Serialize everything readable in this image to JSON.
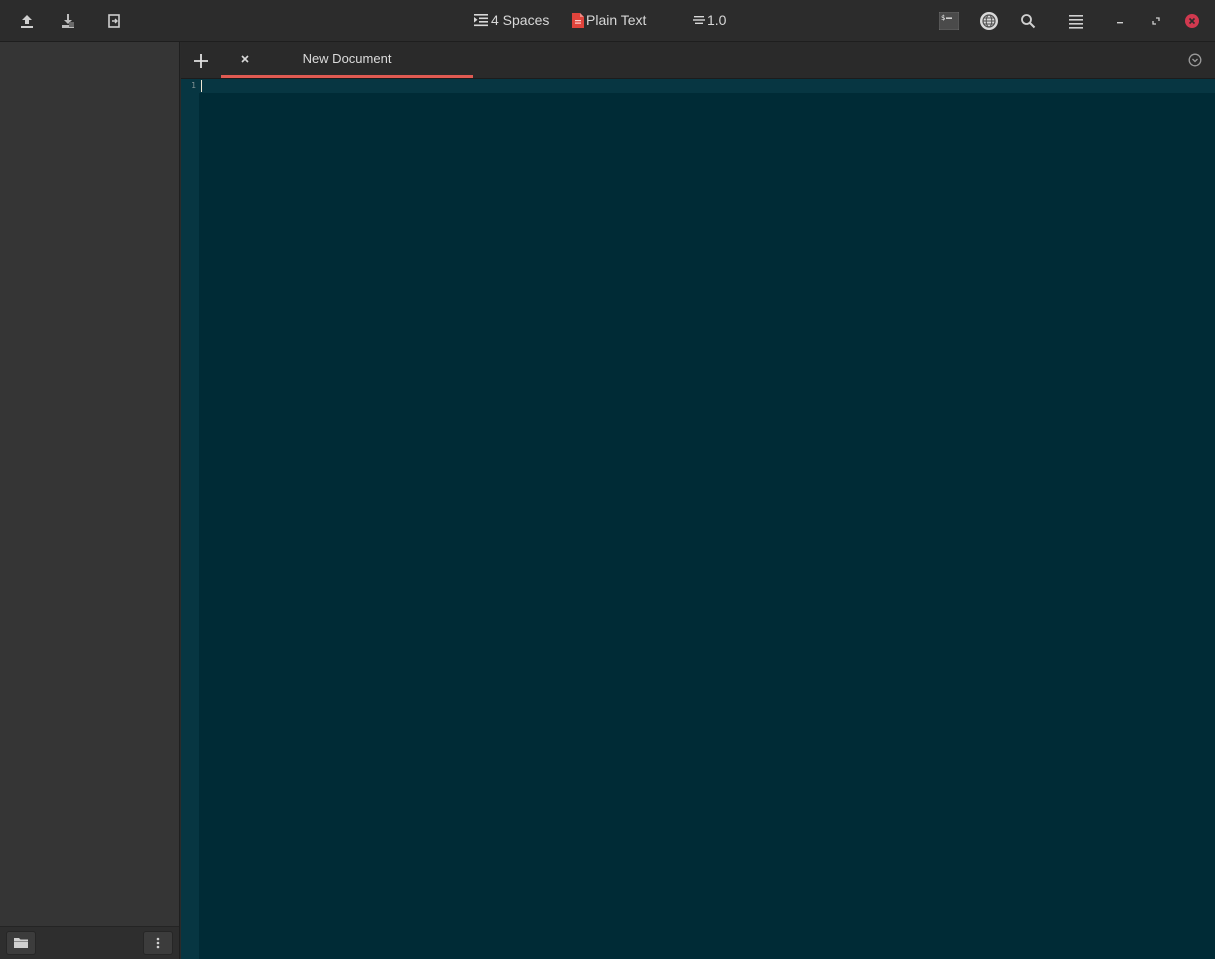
{
  "header": {
    "buttons": [
      {
        "name": "open-icon"
      },
      {
        "name": "save-as-icon"
      },
      {
        "name": "revert-icon"
      }
    ],
    "indent_label": "4 Spaces",
    "language_label": "Plain Text",
    "line_spacing_label": "1.0",
    "right_buttons": [
      {
        "name": "terminal-icon"
      },
      {
        "name": "web-preview-icon"
      },
      {
        "name": "search-icon"
      },
      {
        "name": "menu-icon"
      },
      {
        "name": "minimize-icon"
      },
      {
        "name": "maximize-icon"
      },
      {
        "name": "close-icon"
      }
    ]
  },
  "tabs": [
    {
      "label": "New Document",
      "active": true
    }
  ],
  "editor": {
    "line_numbers": [
      "1"
    ],
    "content": ""
  },
  "sidebar": {
    "footer_buttons": [
      "folder-icon",
      "more-options-icon"
    ]
  },
  "colors": {
    "accent": "#e05a52",
    "editor_bg": "#002b36",
    "gutter_bg": "#073642",
    "sidebar_bg": "#353535",
    "close_button": "#d1394f"
  }
}
